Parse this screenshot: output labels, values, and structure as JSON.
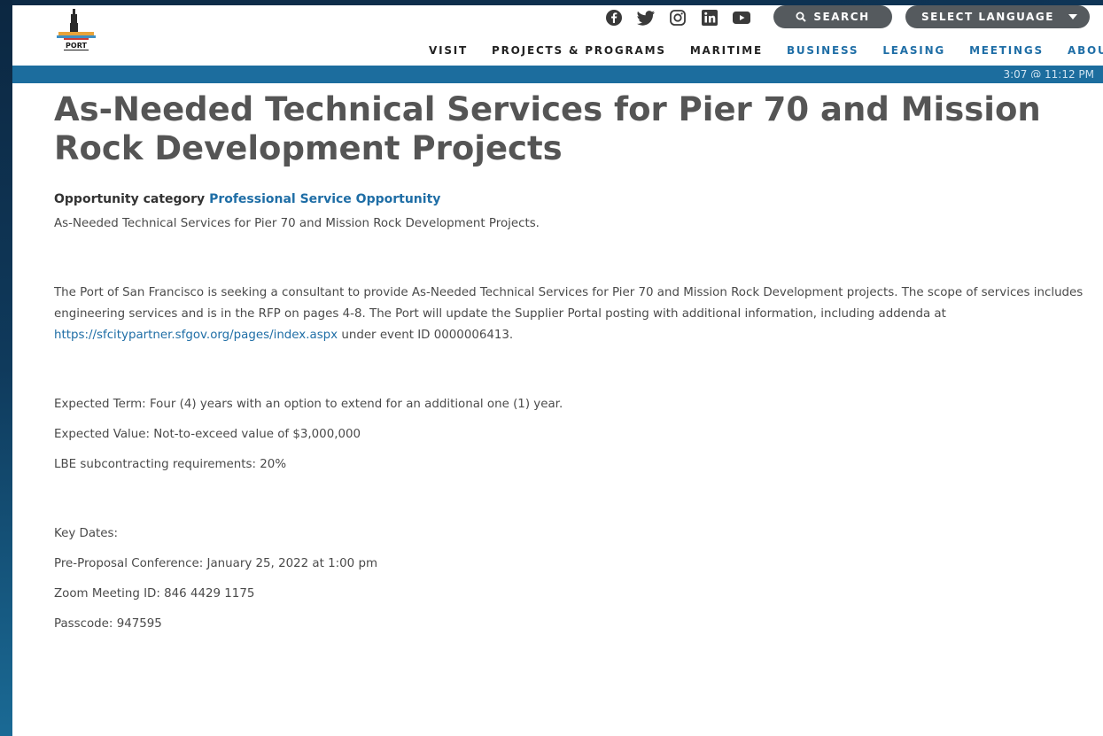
{
  "header": {
    "logo_text": "PORT",
    "social": [
      "facebook-icon",
      "twitter-icon",
      "instagram-icon",
      "linkedin-icon",
      "youtube-icon"
    ],
    "search_label": "SEARCH",
    "language_label": "SELECT LANGUAGE"
  },
  "nav": {
    "items": [
      {
        "label": "VISIT",
        "style": "dark"
      },
      {
        "label": "PROJECTS & PROGRAMS",
        "style": "dark"
      },
      {
        "label": "MARITIME",
        "style": "dark"
      },
      {
        "label": "BUSINESS",
        "style": "blue"
      },
      {
        "label": "LEASING",
        "style": "blue"
      },
      {
        "label": "MEETINGS",
        "style": "blue"
      },
      {
        "label": "ABOUT",
        "style": "blue"
      }
    ]
  },
  "bar": {
    "text": "3:07 @ 11:12 PM"
  },
  "main": {
    "title": "As-Needed Technical Services for Pier 70 and Mission Rock Development Projects",
    "category_label": "Opportunity category",
    "category_value": "Professional Service Opportunity",
    "summary": "As-Needed Technical Services for Pier 70 and Mission Rock Development Projects.",
    "description_before": "The Port of San Francisco is seeking a consultant to provide As-Needed Technical Services for Pier 70 and Mission Rock Development projects. The scope of services includes engineering services and is in the RFP on pages 4-8. The Port will update the Supplier Portal posting with additional information, including addenda at ",
    "description_link": "https://sfcitypartner.sfgov.org/pages/index.aspx",
    "description_after": " under event ID 0000006413.",
    "term": "Expected Term: Four (4) years with an option to extend for an additional one (1) year.",
    "value": "Expected Value: Not-to-exceed value of $3,000,000",
    "lbe": "LBE subcontracting requirements: 20%",
    "key_dates": "Key Dates:",
    "conference": "Pre-Proposal Conference: January 25, 2022 at 1:00 pm",
    "zoom": "Zoom Meeting ID: 846 4429 1175",
    "passcode": "Passcode: 947595"
  },
  "colors": {
    "accent_blue": "#1f6ea6",
    "bar_blue": "#1c6d9e",
    "button_gray": "#555a5e"
  }
}
